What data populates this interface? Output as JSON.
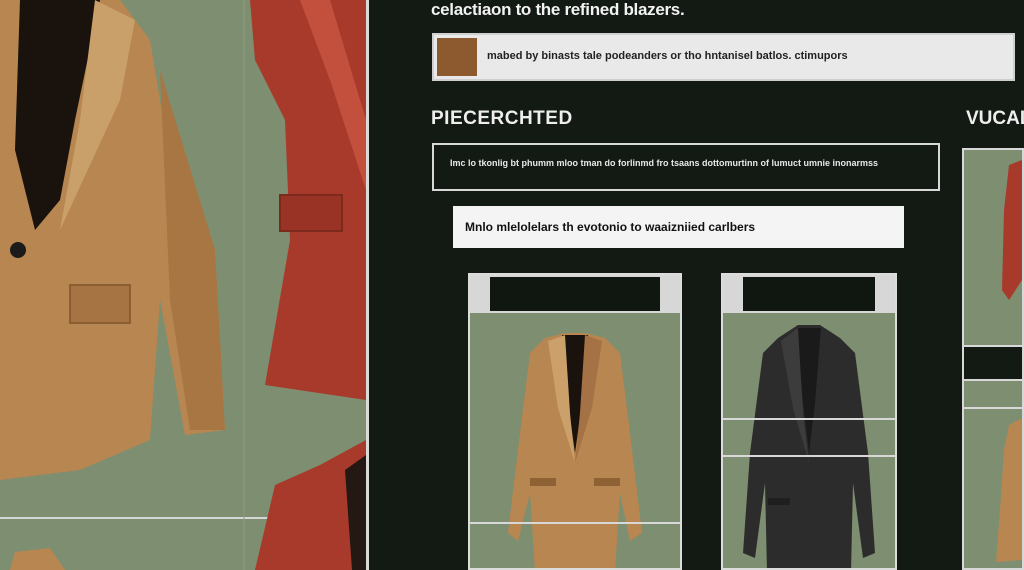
{
  "header": {
    "title": "celactiaon to the refined blazers."
  },
  "banner": {
    "text": "mabed by binasts tale podeanders or tho hntanisel batlos. ctimupors",
    "swatch_color": "#8c5a2e"
  },
  "section": {
    "heading": "PIECERCHTED",
    "heading_right": "VUCAL"
  },
  "description": {
    "text": "Imc lo tkonlig bt phumm mloo tman do forlinmd fro tsaans dottomurtinn of lumuct umnie inonarmss"
  },
  "search": {
    "value": "Mnlo mlelolelars th evotonio to waaizniied carlbers"
  },
  "colors": {
    "panel_bg": "#7e8e70",
    "page_bg": "#121a13",
    "camel": "#b88650",
    "red": "#a83a2c",
    "black": "#2c2c2c"
  },
  "products": [
    {
      "name": "camel-blazer",
      "color": "camel"
    },
    {
      "name": "black-blazer",
      "color": "black"
    },
    {
      "name": "red-blazer",
      "color": "red"
    }
  ]
}
